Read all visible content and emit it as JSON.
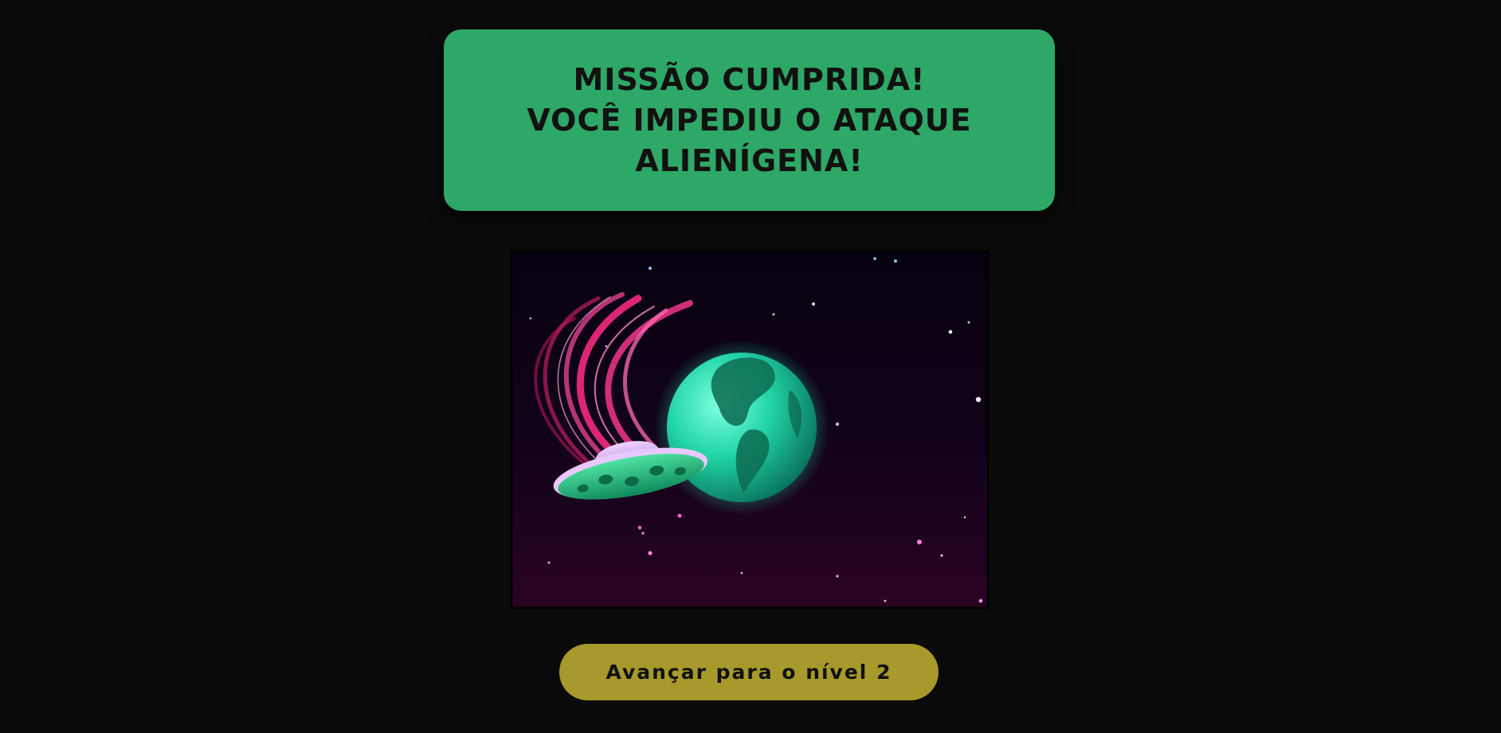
{
  "banner": {
    "title": "MISSÃO CUMPRIDA!\nVOCÊ IMPEDIU O ATAQUE\nALIENÍGENA!",
    "background_color": "#2ea866",
    "text_color": "#111111"
  },
  "scene": {
    "icons": [
      "flying-saucer-icon",
      "earth-globe-icon",
      "star-icon"
    ]
  },
  "actions": {
    "advance_label": "Avançar para o nível 2",
    "button_color": "#a7992b"
  },
  "page": {
    "background_color": "#0a0a0a"
  }
}
